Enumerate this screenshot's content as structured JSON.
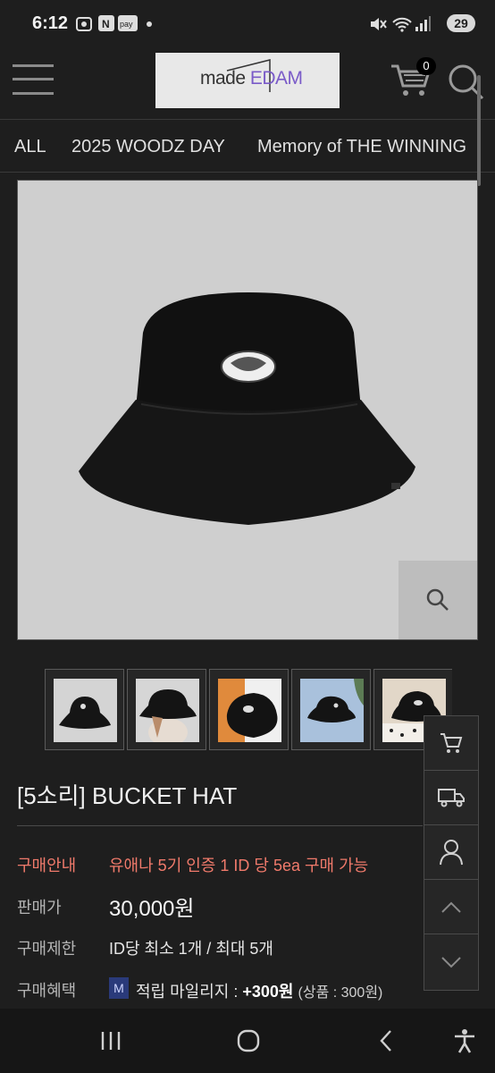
{
  "status": {
    "time": "6:12",
    "battery": "29"
  },
  "header": {
    "logo_made": "made",
    "logo_edam": "EDAM",
    "cart_count": "0"
  },
  "categories": [
    "ALL",
    "2025 WOODZ DAY",
    "Memory of THE WINNING"
  ],
  "product": {
    "title": "[5소리] BUCKET HAT",
    "rows": [
      {
        "label": "구매안내",
        "value": "유애나 5기 인증 1 ID 당 5ea 구매 가능"
      },
      {
        "label": "판매가",
        "value": "30,000원"
      },
      {
        "label": "구매제한",
        "value": "ID당 최소 1개 / 최대 5개"
      },
      {
        "label": "구매혜택",
        "value": ""
      }
    ],
    "mileage_badge": "M",
    "mileage_label": "적립 마일리지 :",
    "mileage_amount": "+300원",
    "mileage_detail": "(상품 : 300원)"
  },
  "icons": {
    "header": [
      "menu-icon",
      "cart-icon",
      "search-icon"
    ],
    "image": [
      "zoom-icon"
    ],
    "sidebar": [
      "cart-icon",
      "truck-icon",
      "user-icon",
      "chevron-up-icon",
      "chevron-down-icon"
    ],
    "navbar": [
      "recent-apps-icon",
      "home-icon",
      "back-icon",
      "accessibility-icon"
    ]
  },
  "colors": {
    "accent_red": "#f07a6b",
    "background": "#1e1e1e",
    "image_bg": "#cfcfcf"
  }
}
